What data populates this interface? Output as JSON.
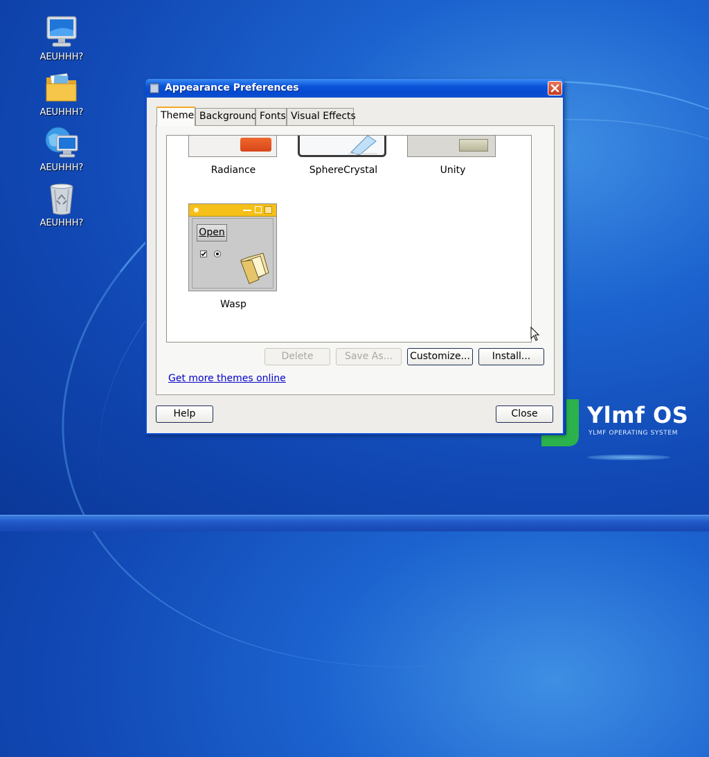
{
  "desktop": {
    "icons": [
      {
        "label": "AEUHHH?",
        "icon": "computer-icon"
      },
      {
        "label": "AEUHHH?",
        "icon": "home-folder-icon"
      },
      {
        "label": "AEUHHH?",
        "icon": "network-icon"
      },
      {
        "label": "AEUHHH?",
        "icon": "trash-icon"
      }
    ]
  },
  "logo": {
    "text": "Ylmf OS",
    "subtitle": "YLMF OPERATING SYSTEM",
    "color": "#2bb24c"
  },
  "window": {
    "title": "Appearance Preferences",
    "tabs": [
      {
        "label": "Theme",
        "active": true
      },
      {
        "label": "Background",
        "active": false
      },
      {
        "label": "Fonts",
        "active": false
      },
      {
        "label": "Visual Effects",
        "active": false
      }
    ],
    "themes": [
      {
        "name": "Radiance"
      },
      {
        "name": "SphereCrystal"
      },
      {
        "name": "Unity"
      },
      {
        "name": "Wasp",
        "preview_button_label": "Open"
      }
    ],
    "buttons": {
      "delete": "Delete",
      "save_as": "Save As...",
      "customize": "Customize...",
      "install": "Install...",
      "help": "Help",
      "close": "Close"
    },
    "link_text": "Get more themes online"
  }
}
